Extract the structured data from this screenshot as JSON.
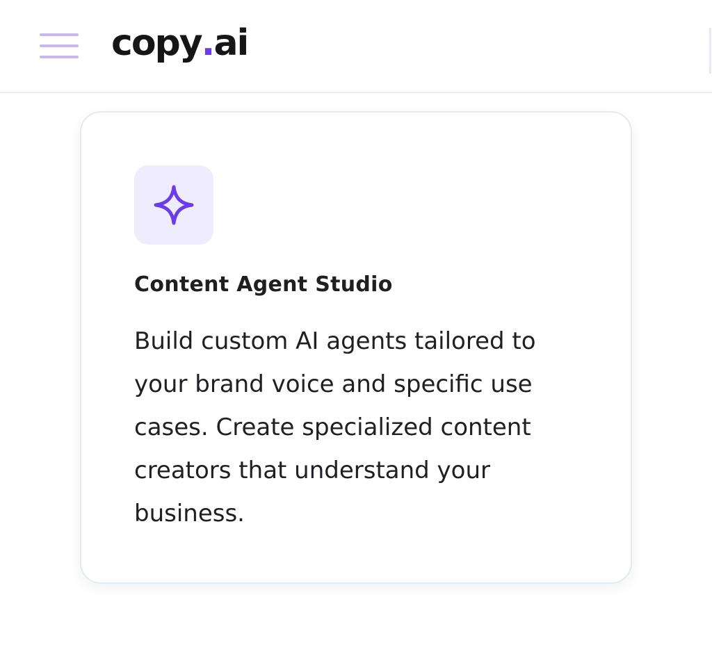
{
  "header": {
    "logo_text": "copy",
    "logo_dot": ".",
    "logo_suffix": "ai",
    "menu_icon": "hamburger-menu-icon"
  },
  "feature_card": {
    "icon": "sparkle-icon",
    "title": "Content Agent Studio",
    "description": "Build custom AI agents tailored to your brand voice and specific use cases. Create specialized content creators that understand your business."
  },
  "colors": {
    "brand_purple": "#6a3de8",
    "icon_tile_bg": "#efecfd",
    "menu_icon_color": "#c7b8f5",
    "card_border": "#e4eaf1"
  }
}
